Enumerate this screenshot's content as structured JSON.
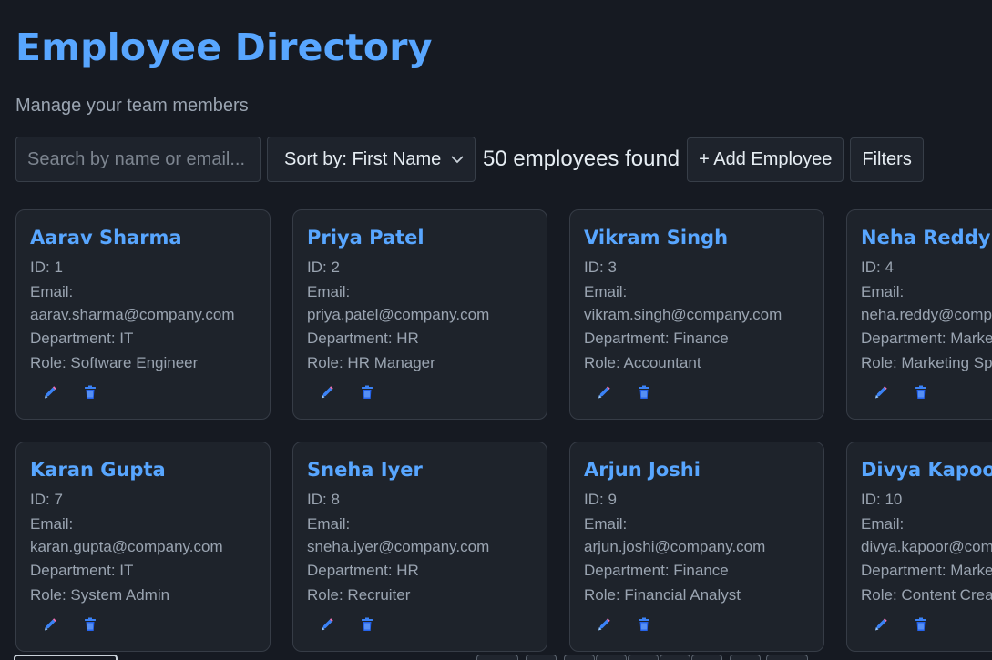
{
  "header": {
    "title": "Employee Directory",
    "subtitle": "Manage your team members"
  },
  "toolbar": {
    "search_placeholder": "Search by name or email...",
    "sort_label": "Sort by: First Name",
    "count_text": "50 employees found",
    "add_label": "+ Add Employee",
    "filters_label": "Filters"
  },
  "labels": {
    "id": "ID: ",
    "email": "Email:",
    "department": "Department: ",
    "role": "Role: "
  },
  "employees": [
    {
      "name": "Aarav Sharma",
      "id": "1",
      "email": "aarav.sharma@company.com",
      "department": "IT",
      "role": "Software Engineer"
    },
    {
      "name": "Priya Patel",
      "id": "2",
      "email": "priya.patel@company.com",
      "department": "HR",
      "role": "HR Manager"
    },
    {
      "name": "Vikram Singh",
      "id": "3",
      "email": "vikram.singh@company.com",
      "department": "Finance",
      "role": "Accountant"
    },
    {
      "name": "Neha Reddy",
      "id": "4",
      "email": "neha.reddy@company.com",
      "department": "Marketing",
      "role": "Marketing Specialist"
    },
    {
      "name": "Karan Gupta",
      "id": "7",
      "email": "karan.gupta@company.com",
      "department": "IT",
      "role": "System Admin"
    },
    {
      "name": "Sneha Iyer",
      "id": "8",
      "email": "sneha.iyer@company.com",
      "department": "HR",
      "role": "Recruiter"
    },
    {
      "name": "Arjun Joshi",
      "id": "9",
      "email": "arjun.joshi@company.com",
      "department": "Finance",
      "role": "Financial Analyst"
    },
    {
      "name": "Divya Kapoor",
      "id": "10",
      "email": "divya.kapoor@company.com",
      "department": "Marketing",
      "role": "Content Creator"
    }
  ],
  "icons": {
    "edit": "pencil-icon",
    "delete": "trash-icon"
  },
  "colors": {
    "accent": "#58a6ff",
    "background": "#161a22",
    "card": "#1e232b",
    "icon": "#3b82f6"
  }
}
